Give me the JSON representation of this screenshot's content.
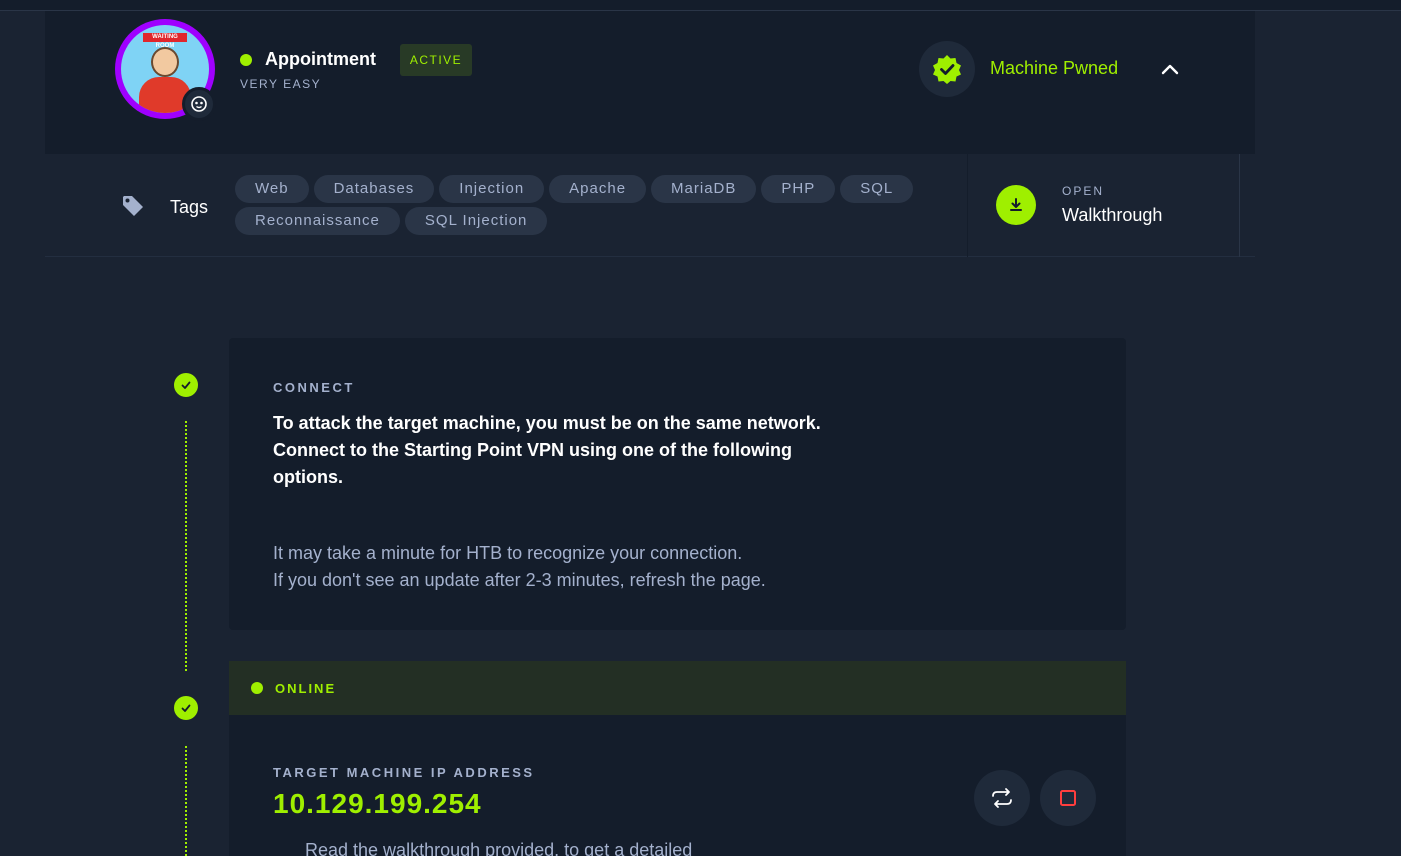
{
  "machine": {
    "name": "Appointment",
    "status": "ACTIVE",
    "difficulty": "VERY EASY",
    "avatar_banner": "WAITING ROOM",
    "pwned_label": "Machine Pwned"
  },
  "tags": {
    "label": "Tags",
    "items": [
      "Web",
      "Databases",
      "Injection",
      "Apache",
      "MariaDB",
      "PHP",
      "SQL",
      "Reconnaissance",
      "SQL Injection"
    ]
  },
  "walkthrough": {
    "open_label": "OPEN",
    "label": "Walkthrough"
  },
  "connect": {
    "heading": "CONNECT",
    "main_line1": "To attack the target machine, you must be on the same network.",
    "main_line2": "Connect to the Starting Point VPN using one of the following options.",
    "sub_line1": "It may take a minute for HTB to recognize your connection.",
    "sub_line2": "If you don't see an update after 2-3 minutes, refresh the page."
  },
  "online": {
    "label": "ONLINE"
  },
  "target": {
    "heading": "TARGET MACHINE IP ADDRESS",
    "ip": "10.129.199.254",
    "note": "Read the walkthrough provided, to get a detailed"
  },
  "colors": {
    "accent": "#9fef00",
    "background": "#1a2332",
    "card": "#141d2b",
    "stop": "#ff3e3e",
    "avatar_ring": "#9f00ff"
  },
  "icons": {
    "os": "linux-icon",
    "pwned": "verified-badge-icon",
    "collapse": "chevron-up-icon",
    "tag": "tag-icon",
    "download": "download-icon",
    "reset": "reset-icon",
    "stop": "stop-icon",
    "step_done": "check-icon"
  }
}
